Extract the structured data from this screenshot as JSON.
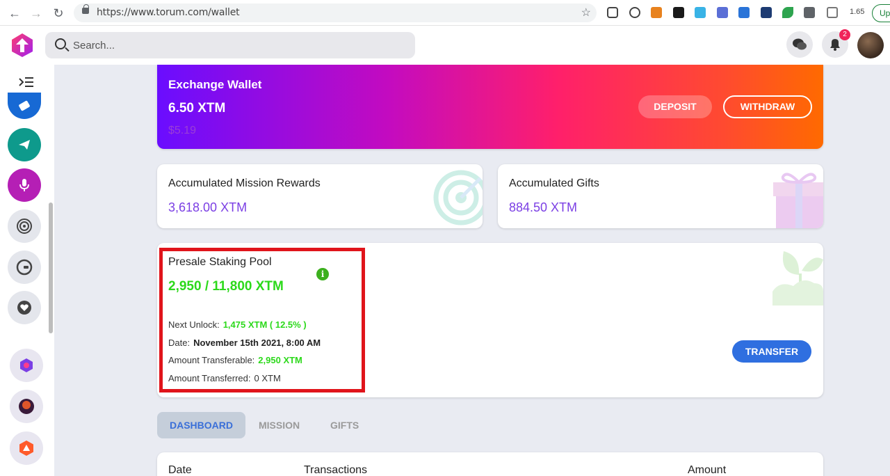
{
  "browser": {
    "url": "https://www.torum.com/wallet",
    "ext_count": "1.65",
    "update_label": "Up"
  },
  "header": {
    "search_placeholder": "Search...",
    "notification_count": "2"
  },
  "exchange_wallet": {
    "title": "Exchange Wallet",
    "balance": "6.50 XTM",
    "usd": "$5.19",
    "deposit_label": "DEPOSIT",
    "withdraw_label": "WITHDRAW"
  },
  "mission_rewards": {
    "label": "Accumulated Mission Rewards",
    "value": "3,618.00 XTM"
  },
  "gifts": {
    "label": "Accumulated Gifts",
    "value": "884.50 XTM"
  },
  "staking": {
    "title": "Presale Staking Pool",
    "value": "2,950 / 11,800 XTM",
    "next_unlock_label": "Next Unlock:",
    "next_unlock_value": "1,475 XTM ( 12.5% )",
    "date_label": "Date:",
    "date_value": "November 15th 2021, 8:00 AM",
    "transferable_label": "Amount Transferable:",
    "transferable_value": "2,950 XTM",
    "transferred_label": "Amount Transferred:",
    "transferred_value": "0 XTM",
    "transfer_label": "TRANSFER"
  },
  "tabs": [
    {
      "label": "DASHBOARD"
    },
    {
      "label": "MISSION"
    },
    {
      "label": "GIFTS"
    }
  ],
  "table": {
    "headers": [
      "Date",
      "Transactions",
      "Amount"
    ]
  },
  "colors": {
    "accent_purple": "#7b3fe4",
    "accent_green": "#2cd91b",
    "transfer_blue": "#2f6fe0",
    "highlight_red": "#e0141b"
  }
}
